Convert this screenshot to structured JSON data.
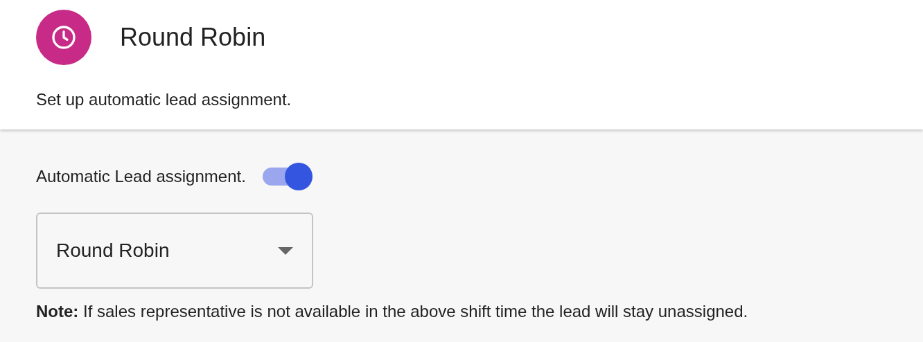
{
  "header": {
    "title": "Round Robin",
    "description": "Set up automatic lead assignment."
  },
  "toggle": {
    "label": "Automatic Lead assignment.",
    "on": true
  },
  "select": {
    "value": "Round Robin"
  },
  "note": "**Note:** If sales representative is not available in the above shift time the lead will stay unassigned."
}
